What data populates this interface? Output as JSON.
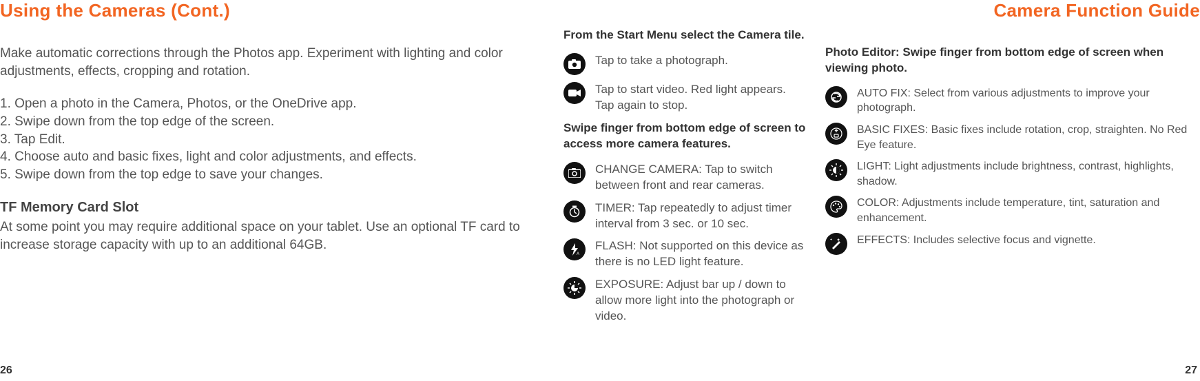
{
  "left": {
    "title": "Using the Cameras (Cont.)",
    "intro": "Make automatic corrections through the Photos app. Experiment with lighting and color adjustments, effects, cropping and rotation.",
    "steps": [
      "1. Open a photo in the Camera, Photos, or the OneDrive app.",
      "2. Swipe down from the top edge of the screen.",
      "3. Tap Edit.",
      "4. Choose auto and basic fixes, light and color adjustments, and effects.",
      "5. Swipe down from the top edge to save your changes."
    ],
    "tfTitle": "TF Memory Card Slot",
    "tfBody": "At some point you may require additional space on your tablet. Use an optional TF card to increase storage capacity with up to an additional 64GB.",
    "pageNum": "26"
  },
  "mid": {
    "start": "From the Start Menu select the Camera tile.",
    "photo": "Tap to take a photograph.",
    "video": "Tap to start video.  Red light appears.\nTap again to stop.",
    "swipe": "Swipe finger from bottom edge of screen to access more camera features.",
    "change": "CHANGE CAMERA: Tap to switch between front and rear cameras.",
    "timer": "TIMER: Tap repeatedly to adjust timer interval from 3 sec. or 10 sec.",
    "flash": "FLASH: Not supported on this device as there is no LED light feature.",
    "exposure": "EXPOSURE: Adjust bar up / down to allow more light into the photograph or video."
  },
  "right": {
    "title": "Camera Function Guide",
    "editor": "Photo Editor: Swipe finger from bottom edge of screen when viewing photo.",
    "autofix": "AUTO FIX: Select from various adjustments to improve your photograph.",
    "basic": "BASIC FIXES: Basic fixes include rotation, crop, straighten.  No Red Eye feature.",
    "light": "LIGHT: Light adjustments include brightness, contrast, highlights, shadow.",
    "color": "COLOR: Adjustments include temperature, tint, saturation and enhancement.",
    "effects": "EFFECTS: Includes selective focus and vignette.",
    "pageNum": "27"
  }
}
